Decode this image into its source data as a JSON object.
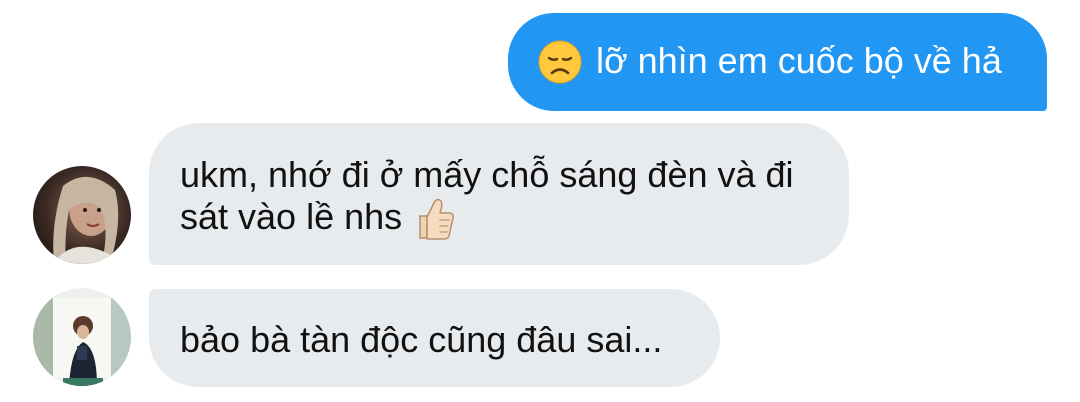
{
  "messages": [
    {
      "direction": "outgoing",
      "emoji": "disappointed-face-emoji",
      "text": "lỡ nhìn em cuốc bộ về hả",
      "bubble_color": "#2196f3"
    },
    {
      "direction": "incoming",
      "avatar": "avatar-girl-1",
      "lines": [
        "ukm, nhớ đi ở mấy chỗ sáng đèn và đi",
        "sát vào lề nhs"
      ],
      "emoji": "thumbs-up-emoji",
      "bubble_color": "#e8ebee"
    },
    {
      "direction": "incoming",
      "avatar": "avatar-girl-2",
      "text": "bảo bà tàn độc cũng đâu sai...",
      "bubble_color": "#e8ebee"
    }
  ]
}
